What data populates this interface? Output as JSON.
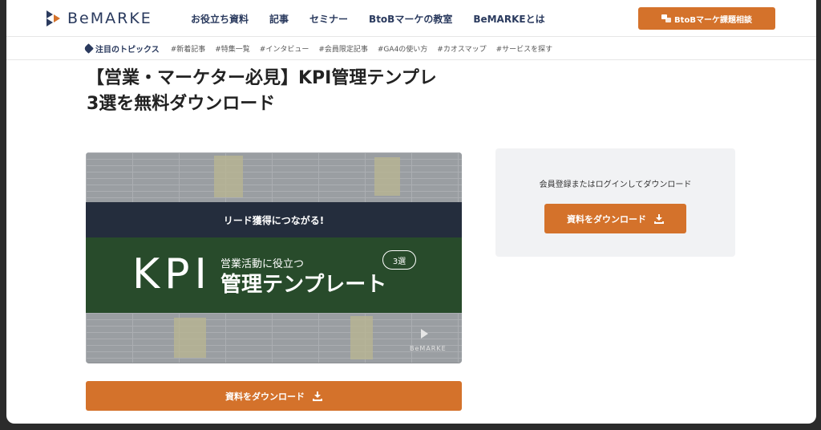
{
  "header": {
    "logo_text": "BeMARKE",
    "nav": [
      "お役立ち資料",
      "記事",
      "セミナー",
      "BtoBマーケの教室",
      "BeMARKEとは"
    ],
    "cta_label": "BtoBマーケ課題相談",
    "cta_icon": "chat-icon"
  },
  "topics": {
    "label": "注目のトピックス",
    "tags": [
      "#新着記事",
      "#特集一覧",
      "#インタビュー",
      "#会員限定記事",
      "#GA4の使い方",
      "#カオスマップ",
      "#サービスを探す"
    ]
  },
  "page": {
    "title_line1": "【営業・マーケター必見】KPI管理テンプレ",
    "title_line2": "3選を無料ダウンロード"
  },
  "thumbnail": {
    "banner_text": "リード獲得につながる!",
    "kpi_text": "KPI",
    "sub_text": "営業活動に役立つ",
    "main_text": "管理テンプレート",
    "badge_text": "3選",
    "watermark": "BeMARKE"
  },
  "download": {
    "main_label": "資料をダウンロード",
    "side_text": "会員登録またはログインしてダウンロード",
    "side_label": "資料をダウンロード",
    "icon": "download-icon"
  },
  "colors": {
    "accent": "#d4722b",
    "navy": "#2a3a5e",
    "banner_dark": "#242d3d",
    "thumb_green": "#284b2b",
    "side_bg": "#f1f2f4"
  }
}
